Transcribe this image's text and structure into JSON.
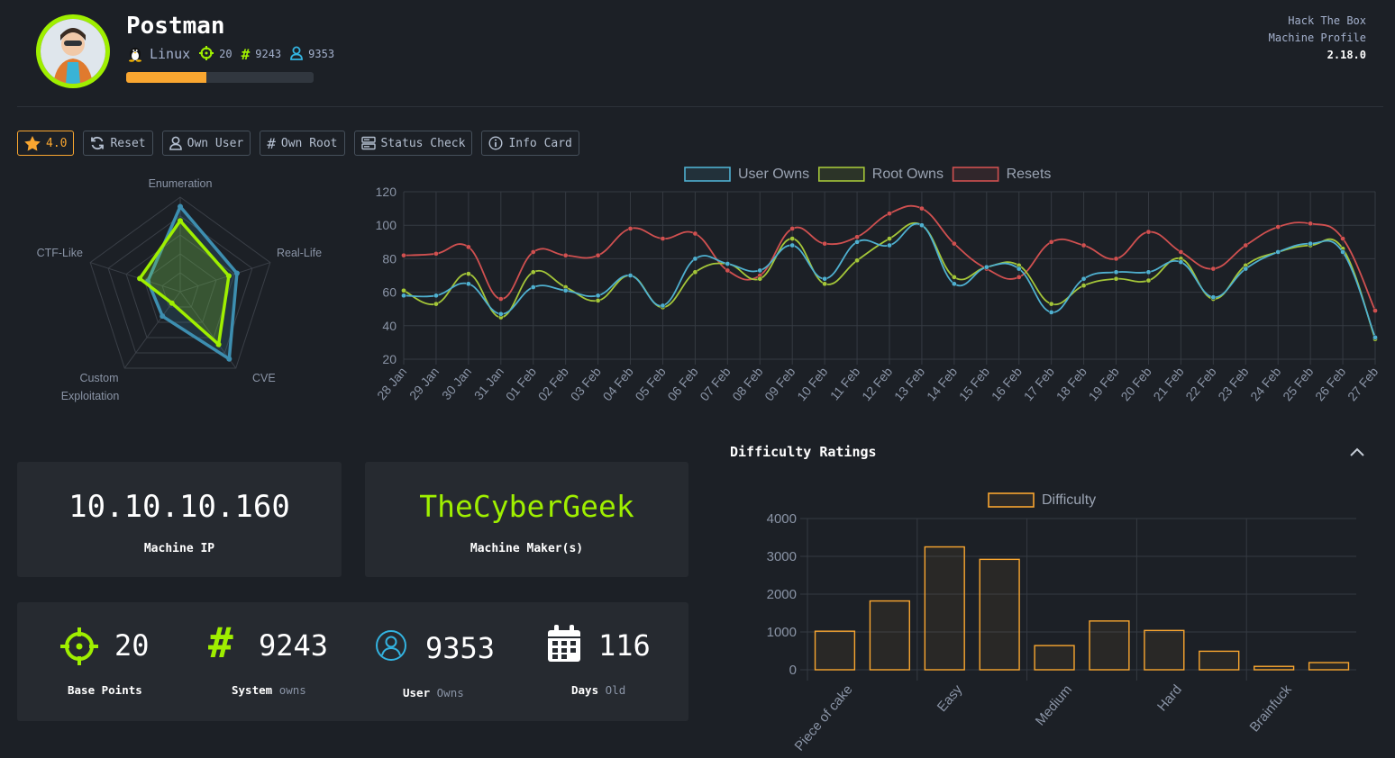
{
  "header": {
    "machine_name": "Postman",
    "os": "Linux",
    "points": "20",
    "system_owns": "9243",
    "user_owns": "9353",
    "progress_fraction": 0.43,
    "brand_line1": "Hack The Box",
    "brand_line2": "Machine Profile",
    "version": "2.18.0",
    "icons": {
      "avatar": "avatar-icon",
      "os": "linux-penguin-icon",
      "points": "target-icon",
      "system": "hash-icon",
      "user": "user-icon"
    }
  },
  "toolbar": {
    "rating": "4.0",
    "reset": "Reset",
    "own_user": "Own User",
    "own_root": "Own Root",
    "status_check": "Status Check",
    "info_card": "Info Card"
  },
  "cards": {
    "ip": "10.10.10.160",
    "ip_label": "Machine IP",
    "maker": "TheCyberGeek",
    "maker_label": "Machine Maker(s)"
  },
  "stats": [
    {
      "value": "20",
      "label_bold": "Base Points",
      "label_muted": "",
      "icon": "crosshair-icon",
      "color": "#9fef00"
    },
    {
      "value": "9243",
      "label_bold": "System",
      "label_muted": "owns",
      "icon": "hash-icon",
      "color": "#9fef00"
    },
    {
      "value": "9353",
      "label_bold": "User",
      "label_muted": "Owns",
      "icon": "user-circle-icon",
      "color": "#33b3e0"
    },
    {
      "value": "116",
      "label_bold": "Days",
      "label_muted": "Old",
      "icon": "calendar-icon",
      "color": "#ffffff"
    }
  ],
  "colors": {
    "accent_green": "#9fef00",
    "accent_orange": "#f9a630",
    "user": "#4fb0d0",
    "root": "#a4c639",
    "reset": "#d05050"
  },
  "chart_data": [
    {
      "type": "radar",
      "categories": [
        "Enumeration",
        "Real-Life",
        "CVE",
        "Custom Exploitation",
        "CTF-Like"
      ],
      "rmax": 10,
      "series": [
        {
          "name": "",
          "values": [
            9,
            6.3,
            8.8,
            3.2,
            3.6
          ],
          "color": "#3d8eb0"
        },
        {
          "name": "",
          "values": [
            7.5,
            5.4,
            6.9,
            1.5,
            4.5
          ],
          "color": "#9fef00"
        }
      ]
    },
    {
      "type": "line",
      "categories": [
        "28 Jan",
        "29 Jan",
        "30 Jan",
        "31 Jan",
        "01 Feb",
        "02 Feb",
        "03 Feb",
        "04 Feb",
        "05 Feb",
        "06 Feb",
        "07 Feb",
        "08 Feb",
        "09 Feb",
        "10 Feb",
        "11 Feb",
        "12 Feb",
        "13 Feb",
        "14 Feb",
        "15 Feb",
        "16 Feb",
        "17 Feb",
        "18 Feb",
        "19 Feb",
        "20 Feb",
        "21 Feb",
        "22 Feb",
        "23 Feb",
        "24 Feb",
        "25 Feb",
        "26 Feb",
        "27 Feb"
      ],
      "ylim": [
        20,
        120
      ],
      "yticks": [
        20,
        40,
        60,
        80,
        100,
        120
      ],
      "series": [
        {
          "name": "User Owns",
          "color": "#4fb0d0",
          "values": [
            58,
            58,
            65,
            47,
            63,
            61,
            58,
            70,
            52,
            80,
            77,
            73,
            88,
            68,
            90,
            88,
            100,
            65,
            75,
            74,
            48,
            68,
            72,
            72,
            78,
            57,
            74,
            84,
            89,
            84,
            33
          ]
        },
        {
          "name": "Root Owns",
          "color": "#a4c639",
          "values": [
            61,
            53,
            71,
            45,
            72,
            63,
            55,
            70,
            51,
            72,
            77,
            68,
            92,
            65,
            79,
            92,
            100,
            69,
            75,
            76,
            53,
            64,
            68,
            67,
            80,
            56,
            76,
            84,
            88,
            86,
            32
          ]
        },
        {
          "name": "Resets",
          "color": "#d05050",
          "values": [
            82,
            83,
            87,
            56,
            84,
            82,
            82,
            98,
            92,
            95,
            73,
            70,
            98,
            89,
            93,
            107,
            110,
            89,
            74,
            69,
            90,
            88,
            80,
            96,
            84,
            74,
            88,
            99,
            101,
            92,
            49
          ]
        }
      ]
    },
    {
      "type": "bar",
      "title": "Difficulty Ratings",
      "legend": "Difficulty",
      "color": "#f9a630",
      "categories": [
        "Piece of cake",
        "",
        "Easy",
        "",
        "Medium",
        "",
        "Hard",
        "",
        "Brainfuck",
        ""
      ],
      "x_labels": [
        "Piece of cake",
        "Easy",
        "Medium",
        "Hard",
        "Brainfuck"
      ],
      "values": [
        1020,
        1820,
        3250,
        2920,
        640,
        1290,
        1040,
        490,
        90,
        190
      ],
      "ylim": [
        0,
        4000
      ],
      "yticks": [
        0,
        1000,
        2000,
        3000,
        4000
      ]
    }
  ]
}
